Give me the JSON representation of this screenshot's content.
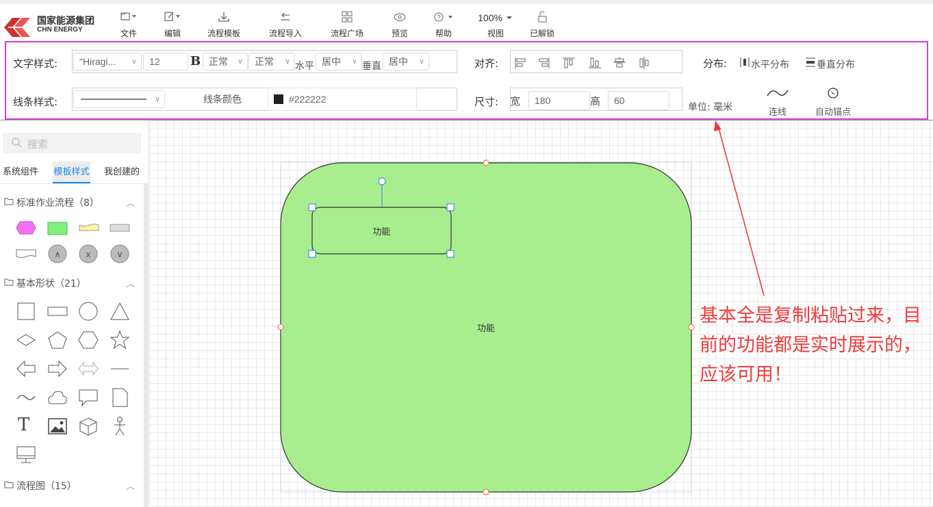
{
  "brand": {
    "name_cn": "国家能源集团",
    "name_en": "CHN ENERGY",
    "color": "#d32f2f"
  },
  "menu": [
    {
      "label": "文件",
      "icon": "file-icon"
    },
    {
      "label": "编辑",
      "icon": "edit-icon"
    },
    {
      "label": "流程模板",
      "icon": "download-icon"
    },
    {
      "label": "流程导入",
      "icon": "import-icon"
    },
    {
      "label": "流程广场",
      "icon": "grid-icon"
    },
    {
      "label": "预览",
      "icon": "eye-icon"
    },
    {
      "label": "帮助",
      "icon": "help-icon"
    },
    {
      "label": "视图",
      "icon": "zoom",
      "value": "100%"
    },
    {
      "label": "已解锁",
      "icon": "unlock-icon"
    }
  ],
  "toolbar": {
    "text_style_label": "文字样式:",
    "font_family": "\"Hiragi...",
    "font_size": "12",
    "bold_label": "B",
    "weight": "正常",
    "style": "正常",
    "h_label": "水平",
    "h_align": "居中",
    "v_label": "垂直",
    "v_align": "居中",
    "align_label": "对齐:",
    "distribute_label": "分布:",
    "h_distribute": "水平分布",
    "v_distribute": "垂直分布",
    "line_style_label": "线条样式:",
    "line_color_label": "线条颜色",
    "line_color_value": "#222222",
    "size_label": "尺寸:",
    "width_label": "宽",
    "width_value": "180",
    "height_label": "高",
    "height_value": "60",
    "unit_label": "单位: 毫米",
    "connect_label": "连线",
    "auto_anchor_label": "自动锚点"
  },
  "sidebar": {
    "search_placeholder": "搜索",
    "tabs": [
      "系统组件",
      "模板样式",
      "我创建的"
    ],
    "active_tab": "模板样式",
    "groups": [
      {
        "title": "标准作业流程（8）"
      },
      {
        "title": "基本形状（21）"
      },
      {
        "title": "流程图（15）"
      }
    ],
    "shape_text_glyph": "T"
  },
  "canvas": {
    "outer_shape_label": "功能",
    "inner_shape_label": "功能",
    "outer_fill": "#a8ee8e",
    "selection_color": "#4a90e2"
  },
  "annotation": {
    "text": "基本全是复制粘贴过来，目前的功能都是实时展示的，应该可用！",
    "color": "#f03c3c"
  }
}
